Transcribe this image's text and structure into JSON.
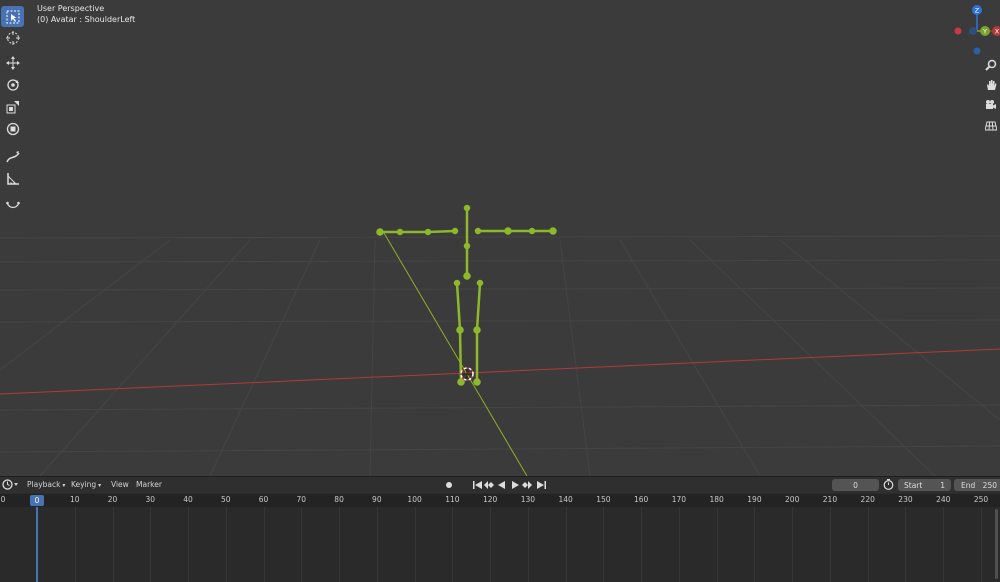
{
  "viewport": {
    "title": "User Perspective",
    "subtitle": "(0) Avatar : ShoulderLeft",
    "colors": {
      "bone": "#8db82a",
      "x_axis": "#b03a3a",
      "y_axis": "#8fae2b",
      "grid": "#454545",
      "background": "#3b3b3b"
    },
    "toolbar": [
      {
        "name": "select-box-icon",
        "active": true
      },
      {
        "name": "cursor-icon",
        "active": false
      },
      {
        "name": "move-icon",
        "active": false
      },
      {
        "name": "rotate-icon",
        "active": false
      },
      {
        "name": "scale-icon",
        "active": false
      },
      {
        "name": "transform-icon",
        "active": false
      },
      {
        "name": "annotate-icon",
        "active": false
      },
      {
        "name": "measure-icon",
        "active": false
      },
      {
        "name": "roll-icon",
        "active": false
      }
    ],
    "gizmo": {
      "z_label": "Z",
      "y_label": "Y",
      "x_label": "X"
    },
    "right_tools": [
      "zoom-icon",
      "hand-pan-icon",
      "camera-icon",
      "grid-view-icon"
    ]
  },
  "timeline": {
    "editor_icon": "clock-icon",
    "menus": {
      "playback": "Playback",
      "keying": "Keying",
      "view": "View",
      "marker": "Marker"
    },
    "current_frame": "0",
    "start_label": "Start",
    "start_value": "1",
    "end_label": "End",
    "end_value": "250",
    "ruler": [
      "0",
      "10",
      "20",
      "30",
      "40",
      "50",
      "60",
      "70",
      "80",
      "90",
      "100",
      "110",
      "120",
      "130",
      "140",
      "150",
      "160",
      "170",
      "180",
      "190",
      "200",
      "210",
      "220",
      "230",
      "240",
      "250"
    ],
    "ruler_left_label": "0",
    "playhead_frame": "0",
    "accent": "#4772b3"
  }
}
